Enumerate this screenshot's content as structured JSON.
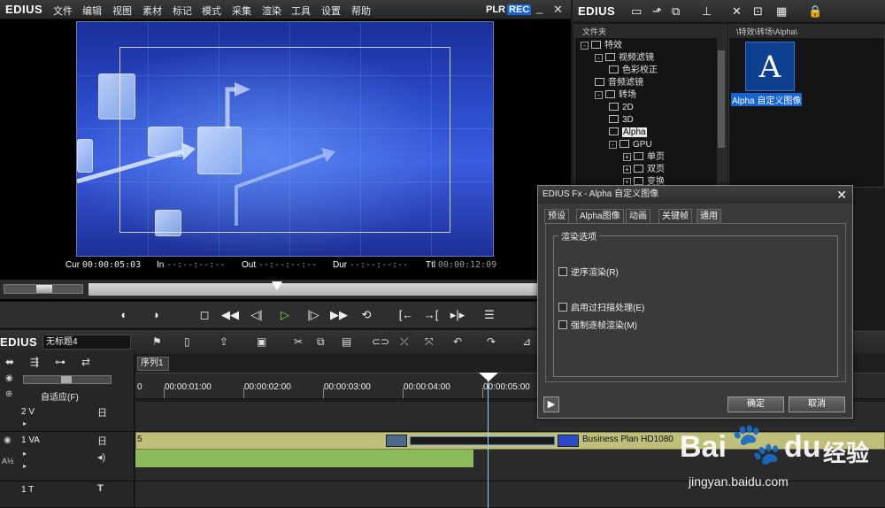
{
  "app": {
    "logo": "EDIUS",
    "menu": [
      "文件",
      "编辑",
      "视图",
      "素材",
      "标记",
      "模式",
      "采集",
      "渲染",
      "工具",
      "设置",
      "帮助"
    ],
    "mode_plr": "PLR",
    "mode_rec": "REC",
    "minimize_glyph": "_",
    "close_glyph": "✕"
  },
  "player": {
    "timecodes": {
      "cur_label": "Cur",
      "cur_value": "00:00:05:03",
      "in_label": "In",
      "in_value": "--:--:--:--",
      "out_label": "Out",
      "out_value": "--:--:--:--",
      "dur_label": "Dur",
      "dur_value": "--:--:--:--",
      "ttl_label": "Ttl",
      "ttl_value": "00:00:12:09"
    },
    "playhead_fraction": 0.39
  },
  "bin": {
    "logo": "EDIUS",
    "folder_header": "文件夹",
    "path": "\\特效\\转场\\Alpha\\",
    "tree": [
      {
        "label": "特效",
        "expander": "-",
        "indent": 0
      },
      {
        "label": "视频滤镜",
        "expander": "-",
        "indent": 1
      },
      {
        "label": "色彩校正",
        "expander": "",
        "indent": 2
      },
      {
        "label": "音频滤镜",
        "expander": "",
        "indent": 1
      },
      {
        "label": "转场",
        "expander": "-",
        "indent": 1
      },
      {
        "label": "2D",
        "expander": "",
        "indent": 2
      },
      {
        "label": "3D",
        "expander": "",
        "indent": 2
      },
      {
        "label": "Alpha",
        "expander": "",
        "indent": 2,
        "selected": true
      },
      {
        "label": "GPU",
        "expander": "-",
        "indent": 2
      },
      {
        "label": "单页",
        "expander": "+",
        "indent": 3
      },
      {
        "label": "双页",
        "expander": "+",
        "indent": 3
      },
      {
        "label": "变换",
        "expander": "+",
        "indent": 3
      }
    ],
    "clip_glyph": "A",
    "clip_caption": "Alpha 自定义图像"
  },
  "dialog": {
    "title": "EDIUS Fx - Alpha 自定义图像",
    "close_glyph": "✕",
    "tabs": [
      "预设",
      "Alpha图像",
      "动画",
      "关键帧",
      "通用"
    ],
    "active_tab": 4,
    "group_title": "渲染选项",
    "options": [
      "逆序渲染(R)",
      "启用过扫描处理(E)",
      "强制逐帧渲染(M)"
    ],
    "play_glyph": "▶",
    "ok_label": "确定",
    "cancel_label": "取消"
  },
  "timeline": {
    "logo": "EDIUS",
    "sequence_name": "无标题4",
    "sequence_tab": "序列1",
    "fit_label": "自适应(F)",
    "ruler_labels": [
      "00:00:01:00",
      "00:00:02:00",
      "00:00:03:00",
      "00:00:04:00",
      "00:00:05:00"
    ],
    "ruler_start": "0",
    "tracks": [
      {
        "name": "2 V"
      },
      {
        "name": "1 VA"
      },
      {
        "name": "1 T"
      }
    ],
    "va_clip_number": "5",
    "va_clip_name": "Business Plan HD1080",
    "track_glyph_day": "日",
    "track_glyph_text": "T"
  },
  "watermark": {
    "brand": "Bai",
    "brand_tail": "du",
    "cn": "经验",
    "url": "jingyan.baidu.com"
  },
  "colors": {
    "accent": "#1565d8",
    "play": "#8bd64a",
    "clip_video": "#bfbe7a",
    "clip_audio": "#8aba5a"
  }
}
